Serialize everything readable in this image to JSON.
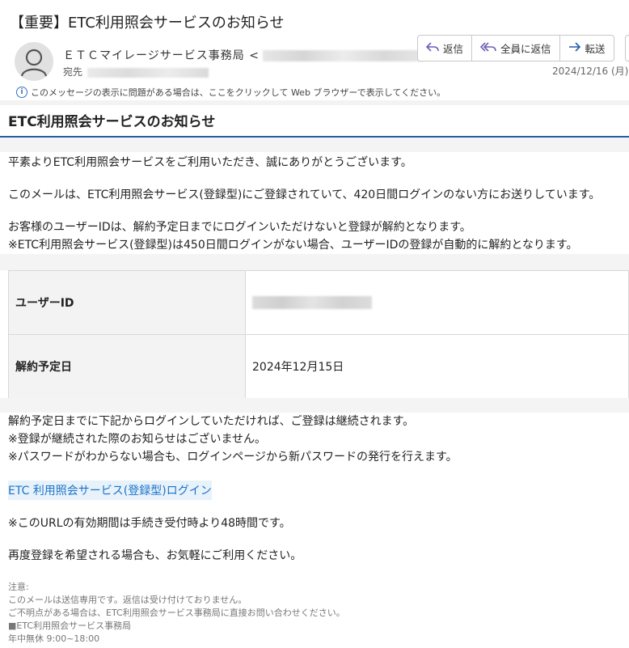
{
  "email": {
    "subject": "【重要】ETC利用照会サービスのお知らせ",
    "sender_name": "ＥＴＣマイレージサービス事務局",
    "sender_email_open": "<",
    "to_label": "宛先",
    "date": "2024/12/16 (月)",
    "notice": "このメッセージの表示に問題がある場合は、ここをクリックして Web ブラウザーで表示してください。"
  },
  "actions": {
    "reply": "返信",
    "reply_all": "全員に返信",
    "forward": "転送"
  },
  "content": {
    "headline": "ETC利用照会サービスのお知らせ",
    "p1": "平素よりETC利用照会サービスをご利用いただき、誠にありがとうございます。",
    "p2": "このメールは、ETC利用照会サービス(登録型)にご登録されていて、420日間ログインのない方にお送りしています。",
    "p3a": "お客様のユーザーIDは、解約予定日までにログインいただけないと登録が解約となります。",
    "p3b": "※ETC利用照会サービス(登録型)は450日間ログインがない場合、ユーザーIDの登録が自動的に解約となります。",
    "table": {
      "user_id_label": "ユーザーID",
      "cancel_date_label": "解約予定日",
      "cancel_date_value": "2024年12月15日"
    },
    "p4a": "解約予定日までに下記からログインしていただければ、ご登録は継続されます。",
    "p4b": "※登録が継続された際のお知らせはございません。",
    "p4c": "※パスワードがわからない場合も、ログインページから新パスワードの発行を行えます。",
    "login_link": "ETC 利用照会サービス(登録型)ログイン",
    "p5": "※このURLの有効期間は手続き受付時より48時間です。",
    "p6": "再度登録を希望される場合も、お気軽にご利用ください。"
  },
  "footer": {
    "l1": "注意:",
    "l2": "このメールは送信専用です。返信は受け付けておりません。",
    "l3": "ご不明点がある場合は、ETC利用照会サービス事務局に直接お問い合わせください。",
    "l4": "■ETC利用照会サービス事務局",
    "l5": "年中無休 9:00~18:00"
  },
  "icons": {
    "avatar": "person-icon",
    "reply": "reply-icon",
    "reply_all": "reply-all-icon",
    "forward": "forward-icon",
    "info": "info-icon"
  },
  "colors": {
    "accent": "#1f5fa8",
    "link": "#1a73c8",
    "action_icon": "#6b5fb5"
  }
}
